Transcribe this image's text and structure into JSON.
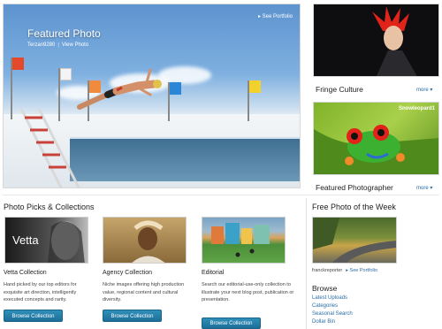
{
  "featured": {
    "title": "Featured Photo",
    "author": "Terzan9280",
    "view_photo": "View Photo",
    "see_portfolio": "See Portfolio"
  },
  "side": {
    "fringe_title": "Fringe Culture",
    "fringe_more": "more",
    "photographer_title": "Featured Photographer",
    "photographer_more": "more",
    "photographer_name": "Snowleopard1"
  },
  "collections": {
    "heading": "Photo Picks & Collections",
    "items": [
      {
        "image_text": "Vetta",
        "title": "Vetta Collection",
        "desc": "Hand picked by our top editors for exquisite art direction, intelligently executed concepts and rarity.",
        "button": "Browse Collection"
      },
      {
        "title": "Agency Collection",
        "desc": "Niche images offering high production value, regional content and cultural diversity.",
        "button": "Browse Collection"
      },
      {
        "title": "Editorial",
        "desc": "Search our editorial-use-only collection to illustrate your next blog post, publication or presentation.",
        "button": "Browse Collection"
      }
    ]
  },
  "free_photo": {
    "heading": "Free Photo of the Week",
    "author": "franckreporter",
    "see_portfolio": "See Portfolio"
  },
  "browse": {
    "heading": "Browse",
    "links": [
      "Latest Uploads",
      "Categories",
      "Seasonal Search",
      "Dollar Bin"
    ]
  },
  "colors": {
    "link": "#2a6da6",
    "button": "#1f76a1"
  }
}
